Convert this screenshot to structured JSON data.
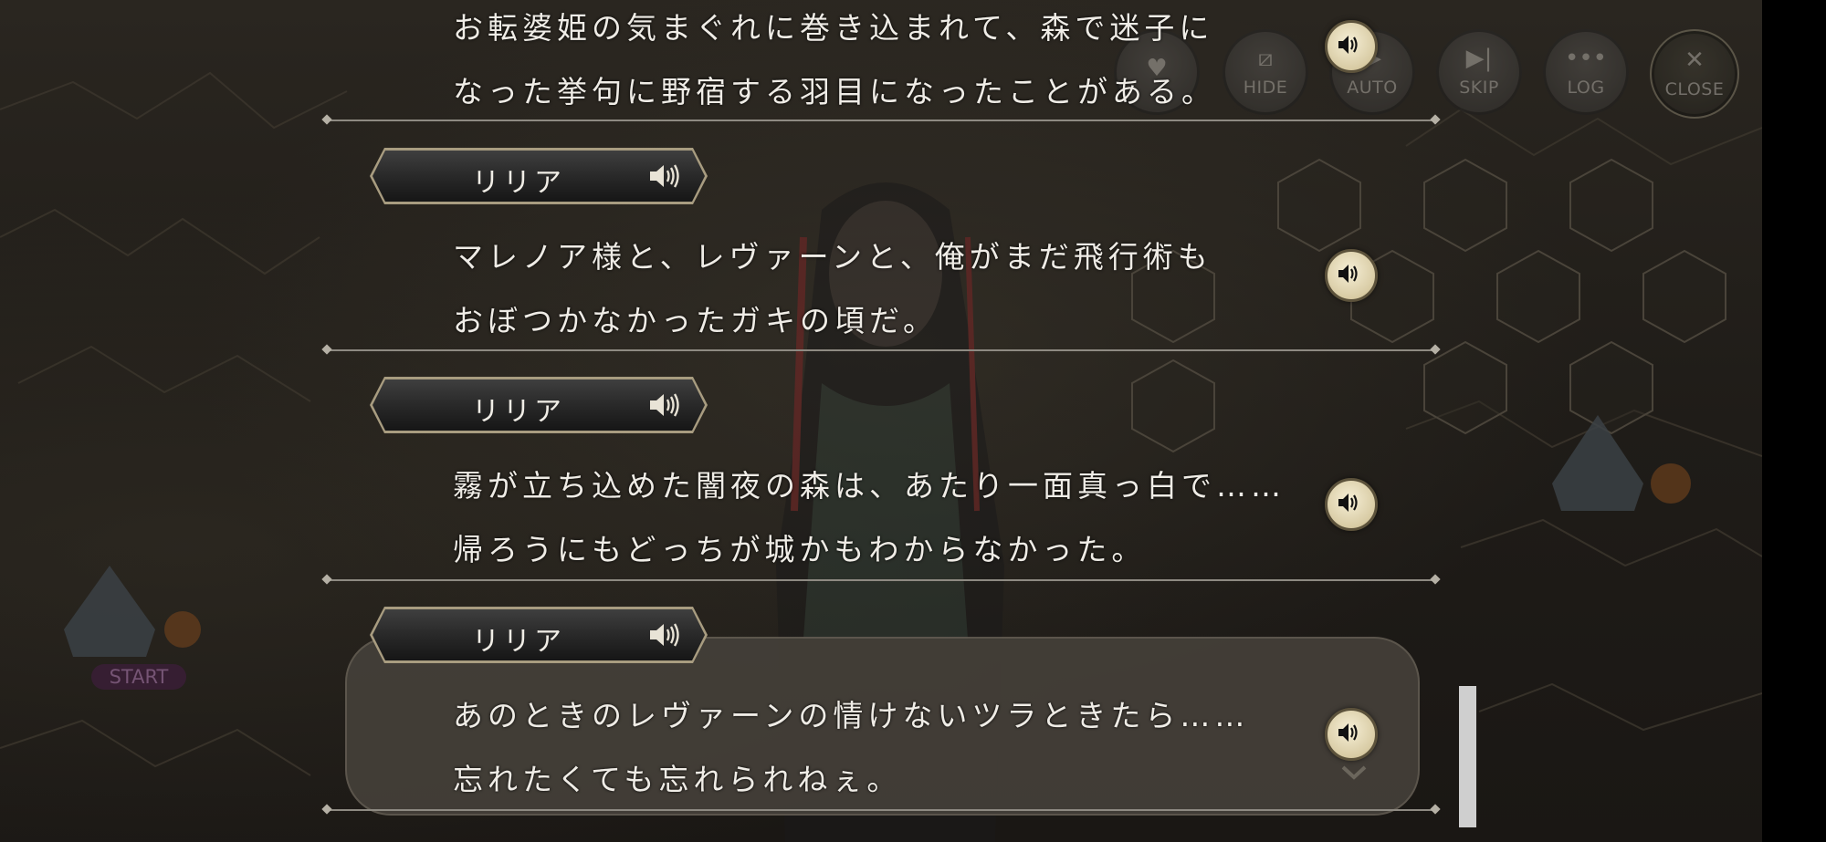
{
  "controls": [
    {
      "id": "favorite",
      "label": "",
      "icon": "heart-icon"
    },
    {
      "id": "hide",
      "label": "HIDE",
      "icon": "hide-icon"
    },
    {
      "id": "auto",
      "label": "AUTO",
      "icon": "auto-icon"
    },
    {
      "id": "skip",
      "label": "SKIP",
      "icon": "skip-icon"
    },
    {
      "id": "log",
      "label": "LOG",
      "icon": "log-icon"
    },
    {
      "id": "close",
      "label": "CLOSE",
      "icon": "close-icon"
    }
  ],
  "background": {
    "start_label": "START"
  },
  "log": {
    "entries": [
      {
        "speaker": "",
        "lines": [
          "お転婆姫の気まぐれに巻き込まれて、森で迷子に",
          "なった挙句に野宿する羽目になったことがある。"
        ]
      },
      {
        "speaker": "リリア",
        "lines": [
          "マレノア様と、レヴァーンと、俺がまだ飛行術も",
          "おぼつかなかったガキの頃だ。"
        ]
      },
      {
        "speaker": "リリア",
        "lines": [
          "霧が立ち込めた闇夜の森は、あたり一面真っ白で……",
          "帰ろうにもどっちが城かもわからなかった。"
        ]
      },
      {
        "speaker": "リリア",
        "lines": [
          "あのときのレヴァーンの情けないツラときたら……",
          "忘れたくても忘れられねぇ。"
        ]
      }
    ]
  },
  "colors": {
    "voice_button": "#e6dcbc",
    "name_plate_border": "#a89c80",
    "text": "#efece6"
  }
}
